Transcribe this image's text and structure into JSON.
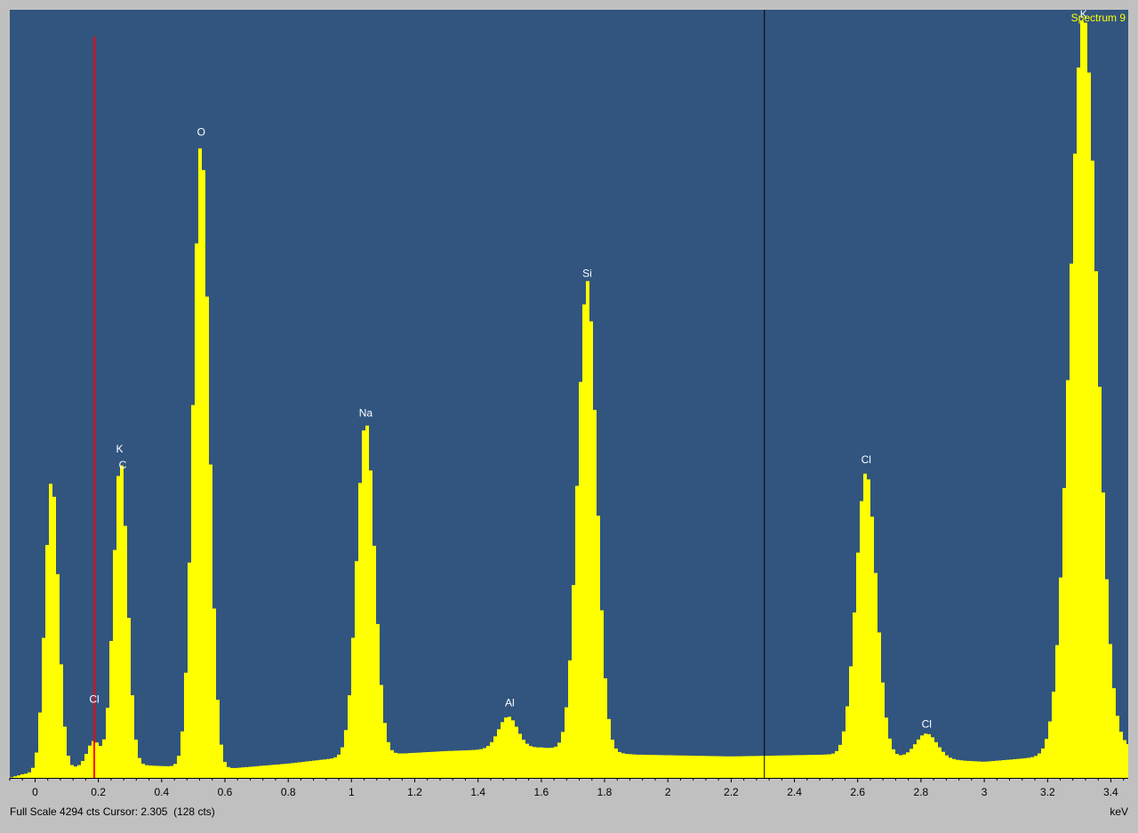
{
  "status": {
    "full_scale": "Full Scale 4294 cts Cursor: 2.305  (128 cts)"
  },
  "colors": {
    "plot_bg": "#31557f",
    "frame_bg": "#c0c0c0",
    "spectrum_fill": "#ffff00",
    "marker_line": "#ff0000",
    "cursor_line": "#000000",
    "peak_label": "#ffffff",
    "spectrum_name": "#ffff00"
  },
  "chart_data": {
    "type": "area",
    "title": "Spectrum 9",
    "xlabel": "keV",
    "ylabel": "",
    "xlim": [
      -0.08,
      3.455
    ],
    "ylim": [
      0,
      4294
    ],
    "grid": false,
    "x_ticks": [
      {
        "value": 0,
        "label": "0"
      },
      {
        "value": 0.2,
        "label": "0.2"
      },
      {
        "value": 0.4,
        "label": "0.4"
      },
      {
        "value": 0.6,
        "label": "0.6"
      },
      {
        "value": 0.8,
        "label": "0.8"
      },
      {
        "value": 1,
        "label": "1"
      },
      {
        "value": 1.2,
        "label": "1.2"
      },
      {
        "value": 1.4,
        "label": "1.4"
      },
      {
        "value": 1.6,
        "label": "1.6"
      },
      {
        "value": 1.8,
        "label": "1.8"
      },
      {
        "value": 2,
        "label": "2"
      },
      {
        "value": 2.2,
        "label": "2.2"
      },
      {
        "value": 2.4,
        "label": "2.4"
      },
      {
        "value": 2.6,
        "label": "2.6"
      },
      {
        "value": 2.8,
        "label": "2.8"
      },
      {
        "value": 3,
        "label": "3"
      },
      {
        "value": 3.2,
        "label": "3.2"
      },
      {
        "value": 3.4,
        "label": "3.4"
      }
    ],
    "marker_kev": 0.187,
    "cursor_kev": 2.305,
    "peak_labels": [
      {
        "text": "K",
        "x": 0.267,
        "y": 1800
      },
      {
        "text": "C",
        "x": 0.277,
        "y": 1710
      },
      {
        "text": "Cl",
        "x": 0.187,
        "y": 400
      },
      {
        "text": "O",
        "x": 0.525,
        "y": 3570
      },
      {
        "text": "Na",
        "x": 1.045,
        "y": 2000
      },
      {
        "text": "Al",
        "x": 1.5,
        "y": 380
      },
      {
        "text": "Si",
        "x": 1.745,
        "y": 2780
      },
      {
        "text": "Cl",
        "x": 2.627,
        "y": 1740
      },
      {
        "text": "Cl",
        "x": 2.818,
        "y": 260
      },
      {
        "text": "K",
        "x": 3.314,
        "y": 4230
      }
    ],
    "series": [
      {
        "peaks": [
          {
            "x": 0.053,
            "y": 1630,
            "sigma": 0.021
          },
          {
            "x": 0.27,
            "y": 1700,
            "sigma": 0.022
          },
          {
            "x": 0.525,
            "y": 3500,
            "sigma": 0.025
          },
          {
            "x": 1.045,
            "y": 1870,
            "sigma": 0.028
          },
          {
            "x": 1.495,
            "y": 180,
            "sigma": 0.03
          },
          {
            "x": 1.745,
            "y": 2630,
            "sigma": 0.03
          },
          {
            "x": 2.627,
            "y": 1590,
            "sigma": 0.032
          },
          {
            "x": 2.818,
            "y": 140,
            "sigma": 0.034
          },
          {
            "x": 3.314,
            "y": 4120,
            "sigma": 0.043
          },
          {
            "x": 0.185,
            "y": 130,
            "sigma": 0.02
          }
        ],
        "background": [
          {
            "x": -0.08,
            "y": 0
          },
          {
            "x": -0.04,
            "y": 20
          },
          {
            "x": 0.0,
            "y": 30
          },
          {
            "x": 0.1,
            "y": 50
          },
          {
            "x": 0.2,
            "y": 80
          },
          {
            "x": 0.35,
            "y": 70
          },
          {
            "x": 0.6,
            "y": 50
          },
          {
            "x": 0.8,
            "y": 80
          },
          {
            "x": 1.0,
            "y": 120
          },
          {
            "x": 1.3,
            "y": 150
          },
          {
            "x": 1.6,
            "y": 170
          },
          {
            "x": 1.9,
            "y": 130
          },
          {
            "x": 2.2,
            "y": 120
          },
          {
            "x": 2.5,
            "y": 130
          },
          {
            "x": 2.8,
            "y": 110
          },
          {
            "x": 3.0,
            "y": 90
          },
          {
            "x": 3.2,
            "y": 120
          },
          {
            "x": 3.455,
            "y": 170
          }
        ]
      }
    ]
  }
}
